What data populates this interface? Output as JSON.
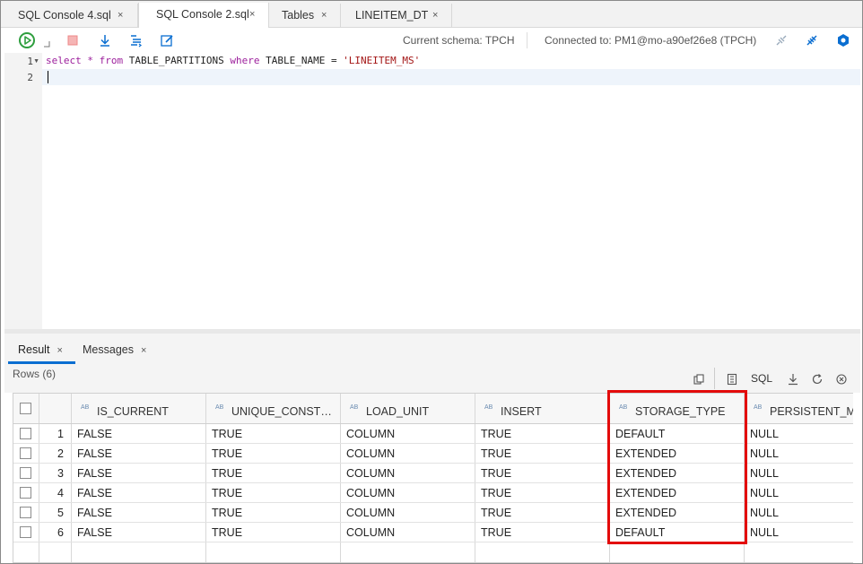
{
  "tabs": [
    {
      "label": "SQL Console 4.sql",
      "close": "×"
    },
    {
      "label": "SQL Console 2.sql",
      "close": "×"
    },
    {
      "label": "Tables",
      "close": "×"
    },
    {
      "label": "LINEITEM_DT",
      "close": "×"
    }
  ],
  "toolbar": {
    "schema": "Current schema: TPCH",
    "connection": "Connected to: PM1@mo-a90ef26e8 (TPCH)"
  },
  "editor": {
    "line_numbers": [
      "1",
      "2"
    ],
    "code": {
      "kw_select": "select",
      "star": " * ",
      "kw_from": "from",
      "table": " TABLE_PARTITIONS ",
      "kw_where": "where",
      "cond": " TABLE_NAME = ",
      "value": "'LINEITEM_MS'"
    }
  },
  "result_tabs": [
    {
      "label": "Result",
      "close": "×"
    },
    {
      "label": "Messages",
      "close": "×"
    }
  ],
  "rows_label": "Rows (6)",
  "result_toolbar": {
    "sql_label": "SQL"
  },
  "grid": {
    "type_badge": "AB",
    "columns": [
      "IS_CURRENT",
      "UNIQUE_CONST…",
      "LOAD_UNIT",
      "INSERT",
      "STORAGE_TYPE",
      "PERSISTENT_M"
    ],
    "rows": [
      {
        "n": "1",
        "cells": [
          "FALSE",
          "TRUE",
          "COLUMN",
          "TRUE",
          "DEFAULT",
          "NULL"
        ]
      },
      {
        "n": "2",
        "cells": [
          "FALSE",
          "TRUE",
          "COLUMN",
          "TRUE",
          "EXTENDED",
          "NULL"
        ]
      },
      {
        "n": "3",
        "cells": [
          "FALSE",
          "TRUE",
          "COLUMN",
          "TRUE",
          "EXTENDED",
          "NULL"
        ]
      },
      {
        "n": "4",
        "cells": [
          "FALSE",
          "TRUE",
          "COLUMN",
          "TRUE",
          "EXTENDED",
          "NULL"
        ]
      },
      {
        "n": "5",
        "cells": [
          "FALSE",
          "TRUE",
          "COLUMN",
          "TRUE",
          "EXTENDED",
          "NULL"
        ]
      },
      {
        "n": "6",
        "cells": [
          "FALSE",
          "TRUE",
          "COLUMN",
          "TRUE",
          "DEFAULT",
          "NULL"
        ]
      }
    ]
  },
  "colors": {
    "run": "#2e9e3e",
    "accent": "#0a6ed1",
    "highlight": "#e30b0b"
  }
}
